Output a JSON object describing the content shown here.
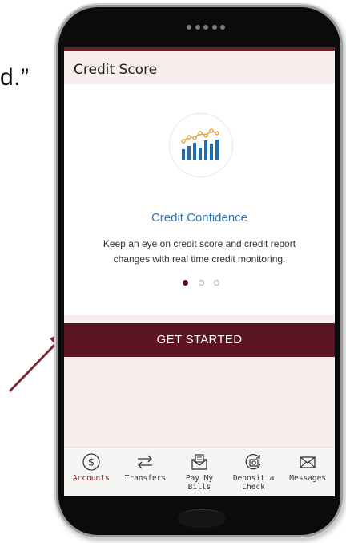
{
  "side_text": "d.”",
  "screen": {
    "title": "Credit Score",
    "card": {
      "title": "Credit Confidence",
      "description": "Keep an eye on credit score and credit report changes with real time credit monitoring.",
      "pager": {
        "total": 3,
        "active": 1
      }
    },
    "cta_label": "GET STARTED"
  },
  "tabbar": {
    "items": [
      {
        "label": "Accounts",
        "icon": "dollar-circle-icon",
        "active": true
      },
      {
        "label": "Transfers",
        "icon": "transfer-arrows-icon",
        "active": false
      },
      {
        "label": "Pay My Bills",
        "icon": "bill-envelope-icon",
        "active": false
      },
      {
        "label": "Deposit a Check",
        "icon": "camera-deposit-icon",
        "active": false
      },
      {
        "label": "Messages",
        "icon": "mail-envelope-icon",
        "active": false
      }
    ]
  },
  "colors": {
    "brand": "#5c1420",
    "link_blue": "#2d74b5",
    "chart_orange": "#e8a23a",
    "chart_blue": "#1f6fb2",
    "screen_bg": "#f7eded"
  }
}
